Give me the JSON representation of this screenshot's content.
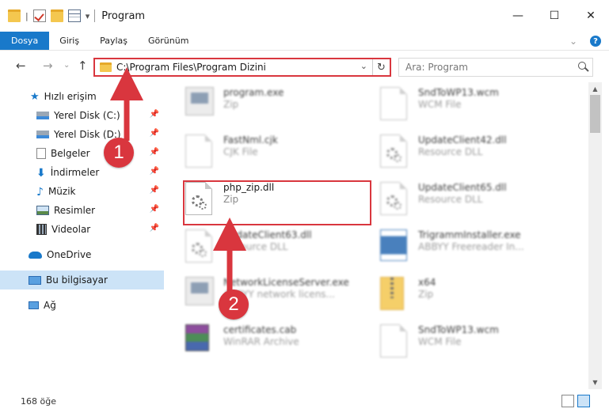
{
  "window": {
    "title": "Program",
    "minimize": "—",
    "maximize": "☐",
    "close": "✕"
  },
  "ribbon": {
    "tabs": [
      "Dosya",
      "Giriş",
      "Paylaş",
      "Görünüm"
    ],
    "expand": "⌄",
    "help": "?"
  },
  "nav": {
    "back": "←",
    "forward": "→",
    "recent": "⌄",
    "up": "↑"
  },
  "address": {
    "path": "C:\\Program Files\\Program Dizini",
    "chevron": "⌄",
    "refresh": "↻"
  },
  "search": {
    "placeholder": "Ara: Program"
  },
  "sidebar": {
    "items": [
      {
        "label": "Hızlı erişim",
        "icon": "star-icon",
        "pinned": false
      },
      {
        "label": "Yerel Disk (C:)",
        "icon": "drive-icon",
        "pinned": true
      },
      {
        "label": "Yerel Disk (D:)",
        "icon": "drive-icon",
        "pinned": true
      },
      {
        "label": "Belgeler",
        "icon": "documents-icon",
        "pinned": true
      },
      {
        "label": "İndirmeler",
        "icon": "download-icon",
        "pinned": true
      },
      {
        "label": "Müzik",
        "icon": "music-icon",
        "pinned": true
      },
      {
        "label": "Resimler",
        "icon": "pictures-icon",
        "pinned": true
      },
      {
        "label": "Videolar",
        "icon": "videos-icon",
        "pinned": true
      },
      {
        "label": "OneDrive",
        "icon": "onedrive-icon",
        "pinned": false
      },
      {
        "label": "Bu bilgisayar",
        "icon": "computer-icon",
        "pinned": false,
        "selected": true
      },
      {
        "label": "Ağ",
        "icon": "network-icon",
        "pinned": false
      }
    ],
    "pin_glyph": "📌"
  },
  "files": [
    {
      "name": "program.exe",
      "type": "Zip",
      "icon": "exe-icon"
    },
    {
      "name": "SndToWP13.wcm",
      "type": "WCM File",
      "icon": "document-icon"
    },
    {
      "name": "FastNml.cjk",
      "type": "CJK File",
      "icon": "document-icon"
    },
    {
      "name": "UpdateClient42.dll",
      "type": "Resource DLL",
      "icon": "dll-icon"
    },
    {
      "name": "php_zip.dll",
      "type": "Zip",
      "icon": "dll-icon"
    },
    {
      "name": "UpdateClient65.dll",
      "type": "Resource DLL",
      "icon": "dll-icon"
    },
    {
      "name": "UpdateClient63.dll",
      "type": "Resource DLL",
      "icon": "dll-icon"
    },
    {
      "name": "TrigrammInstaller.exe",
      "type": "ABBYY Freereader In...",
      "icon": "installer-icon"
    },
    {
      "name": "NetworkLicenseServer.exe",
      "type": "ABBYY network licens...",
      "icon": "exe-icon"
    },
    {
      "name": "x64",
      "type": "Zip",
      "icon": "zip-folder-icon"
    },
    {
      "name": "certificates.cab",
      "type": "WinRAR Archive",
      "icon": "winrar-icon"
    },
    {
      "name": "SndToWP13.wcm",
      "type": "WCM File",
      "icon": "document-icon"
    }
  ],
  "annotations": {
    "step1": "1",
    "step2": "2",
    "color": "#d9363e"
  },
  "status": {
    "count": "168 öğe"
  },
  "colors": {
    "accent": "#1979ca",
    "selection": "#cce3f7",
    "highlight": "#d9363e"
  }
}
